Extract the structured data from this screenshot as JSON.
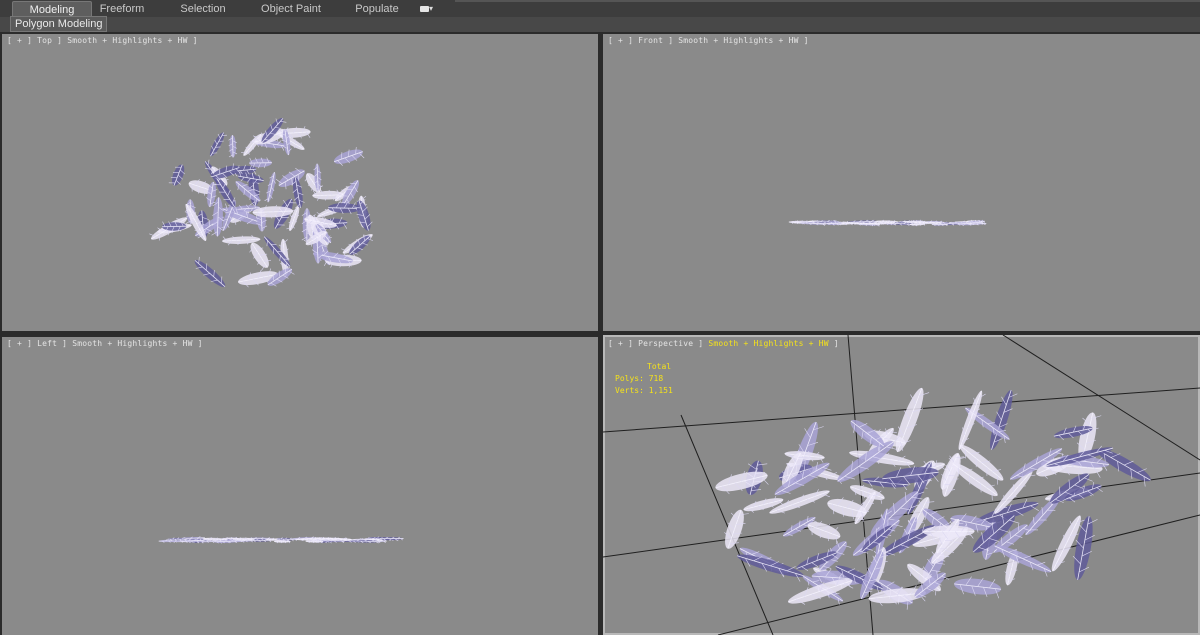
{
  "ribbon": {
    "tabs": [
      {
        "label": "Modeling",
        "active": true
      },
      {
        "label": "Freeform",
        "active": false
      },
      {
        "label": "Selection",
        "active": false
      },
      {
        "label": "Object Paint",
        "active": false
      },
      {
        "label": "Populate",
        "active": false
      }
    ],
    "panel_label": "Polygon Modeling"
  },
  "viewports": {
    "top": {
      "label": "[ + ] Top ] Smooth + Highlights + HW ]"
    },
    "front": {
      "label": "[ + ] Front ] Smooth + Highlights + HW ]"
    },
    "left": {
      "label": "[ + ] Left ] Smooth + Highlights + HW ]"
    },
    "perspective": {
      "label_prefix": "[ + ] Perspective ]",
      "label_shading": " Smooth + Highlights + HW ",
      "label_suffix": "]",
      "stats": {
        "total_label": "Total",
        "polys_label": "Polys:",
        "polys_value": "718",
        "verts_label": "Verts:",
        "verts_value": "1,151"
      }
    }
  },
  "colors": {
    "viewport_bg": "#8a8a8a",
    "feather_light": "#ece8f8",
    "feather_mid": "#a9a3d6",
    "feather_dark": "#5f5a99",
    "stat_text": "#f5e21a",
    "grid_line": "#1f1f1f"
  }
}
